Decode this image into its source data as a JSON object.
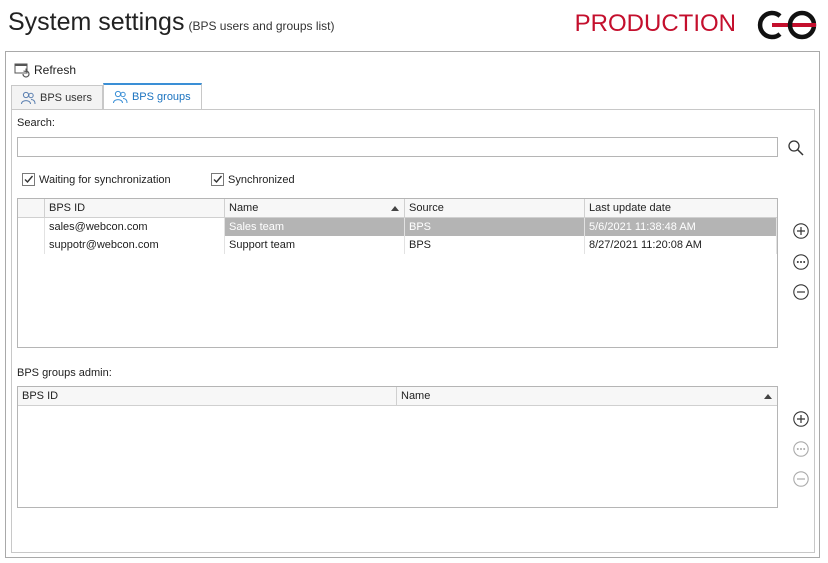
{
  "header": {
    "title": "System settings",
    "subtitle": "(BPS users and groups list)",
    "environment": "PRODUCTION",
    "accent_color": "#c40f2d"
  },
  "toolbar": {
    "refresh_label": "Refresh",
    "refresh_icon": "refresh-icon"
  },
  "tabs": [
    {
      "label": "BPS users",
      "icon": "user-icon",
      "active": false
    },
    {
      "label": "BPS groups",
      "icon": "group-icon",
      "active": true
    }
  ],
  "search": {
    "label": "Search:",
    "value": "",
    "icon": "search-icon"
  },
  "filters": [
    {
      "label": "Waiting for synchronization",
      "checked": true
    },
    {
      "label": "Synchronized",
      "checked": true
    }
  ],
  "groups_grid": {
    "columns": [
      "BPS ID",
      "Name",
      "Source",
      "Last update date"
    ],
    "sorted_column": "Name",
    "rows": [
      {
        "bps_id": "sales@webcon.com",
        "name": "Sales team",
        "source": "BPS",
        "last_update": "5/6/2021 11:38:48 AM",
        "selected": true
      },
      {
        "bps_id": "suppotr@webcon.com",
        "name": "Support team",
        "source": "BPS",
        "last_update": "8/27/2021 11:20:08 AM",
        "selected": false
      }
    ]
  },
  "admin": {
    "label": "BPS groups admin:",
    "columns": [
      "BPS ID",
      "Name"
    ],
    "sorted_column": "Name",
    "rows": []
  },
  "side_buttons": {
    "groups": [
      "add-icon",
      "more-icon",
      "remove-icon"
    ],
    "admin": [
      "add-icon",
      "more-icon",
      "remove-icon"
    ]
  }
}
